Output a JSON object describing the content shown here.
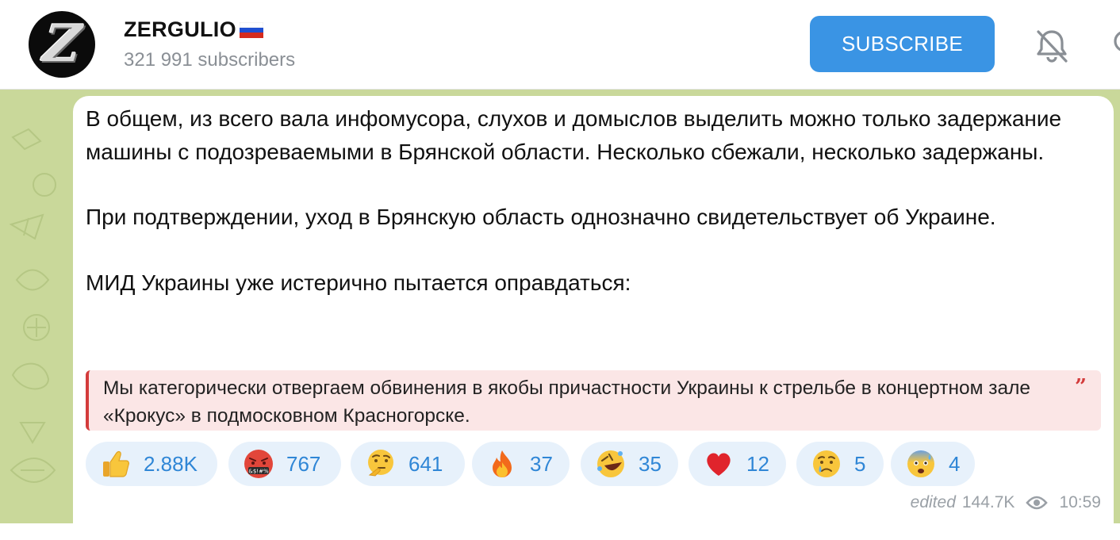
{
  "channel": {
    "name": "ZERGULIO",
    "flag_emoji": "🇷🇺",
    "subscribers": "321 991 subscribers",
    "avatar_letter": "Z"
  },
  "header": {
    "subscribe_label": "SUBSCRIBE",
    "icons": [
      "bell-off-icon",
      "search-icon"
    ]
  },
  "message": {
    "paragraphs": [
      "В общем, из всего вала инфомусора, слухов и домыслов выделить можно только задержание машины с подозреваемыми в Брянской области. Несколько сбежали, несколько задержаны.",
      "При подтверждении, уход в Брянскую область однозначно свидетельствует об Украине.",
      "МИД Украины уже истерично пытается оправдаться:"
    ],
    "quote": "Мы категорически отвергаем обвинения в якобы причастности Украины к стрельбе в концертном зале «Крокус» в подмосковном Красногорске.",
    "reactions": [
      {
        "emoji": "thumbs-up",
        "count": "2.88K"
      },
      {
        "emoji": "face-with-symbols-on-mouth",
        "count": "767"
      },
      {
        "emoji": "thinking-face",
        "count": "641"
      },
      {
        "emoji": "fire",
        "count": "37"
      },
      {
        "emoji": "rolling-on-floor-laughing",
        "count": "35"
      },
      {
        "emoji": "red-heart",
        "count": "12"
      },
      {
        "emoji": "crying-face",
        "count": "5"
      },
      {
        "emoji": "anxious-face-with-sweat",
        "count": "4"
      }
    ],
    "edited_label": "edited",
    "views": "144.7K",
    "time": "10:59"
  },
  "colors": {
    "accent": "#3a94e4",
    "reaction_bg": "#e7f1fb",
    "reaction_text": "#2f86d6",
    "quote_bar": "#d33b3b",
    "quote_bg": "#fbe6e6",
    "chat_bg": "#c9d89a"
  }
}
